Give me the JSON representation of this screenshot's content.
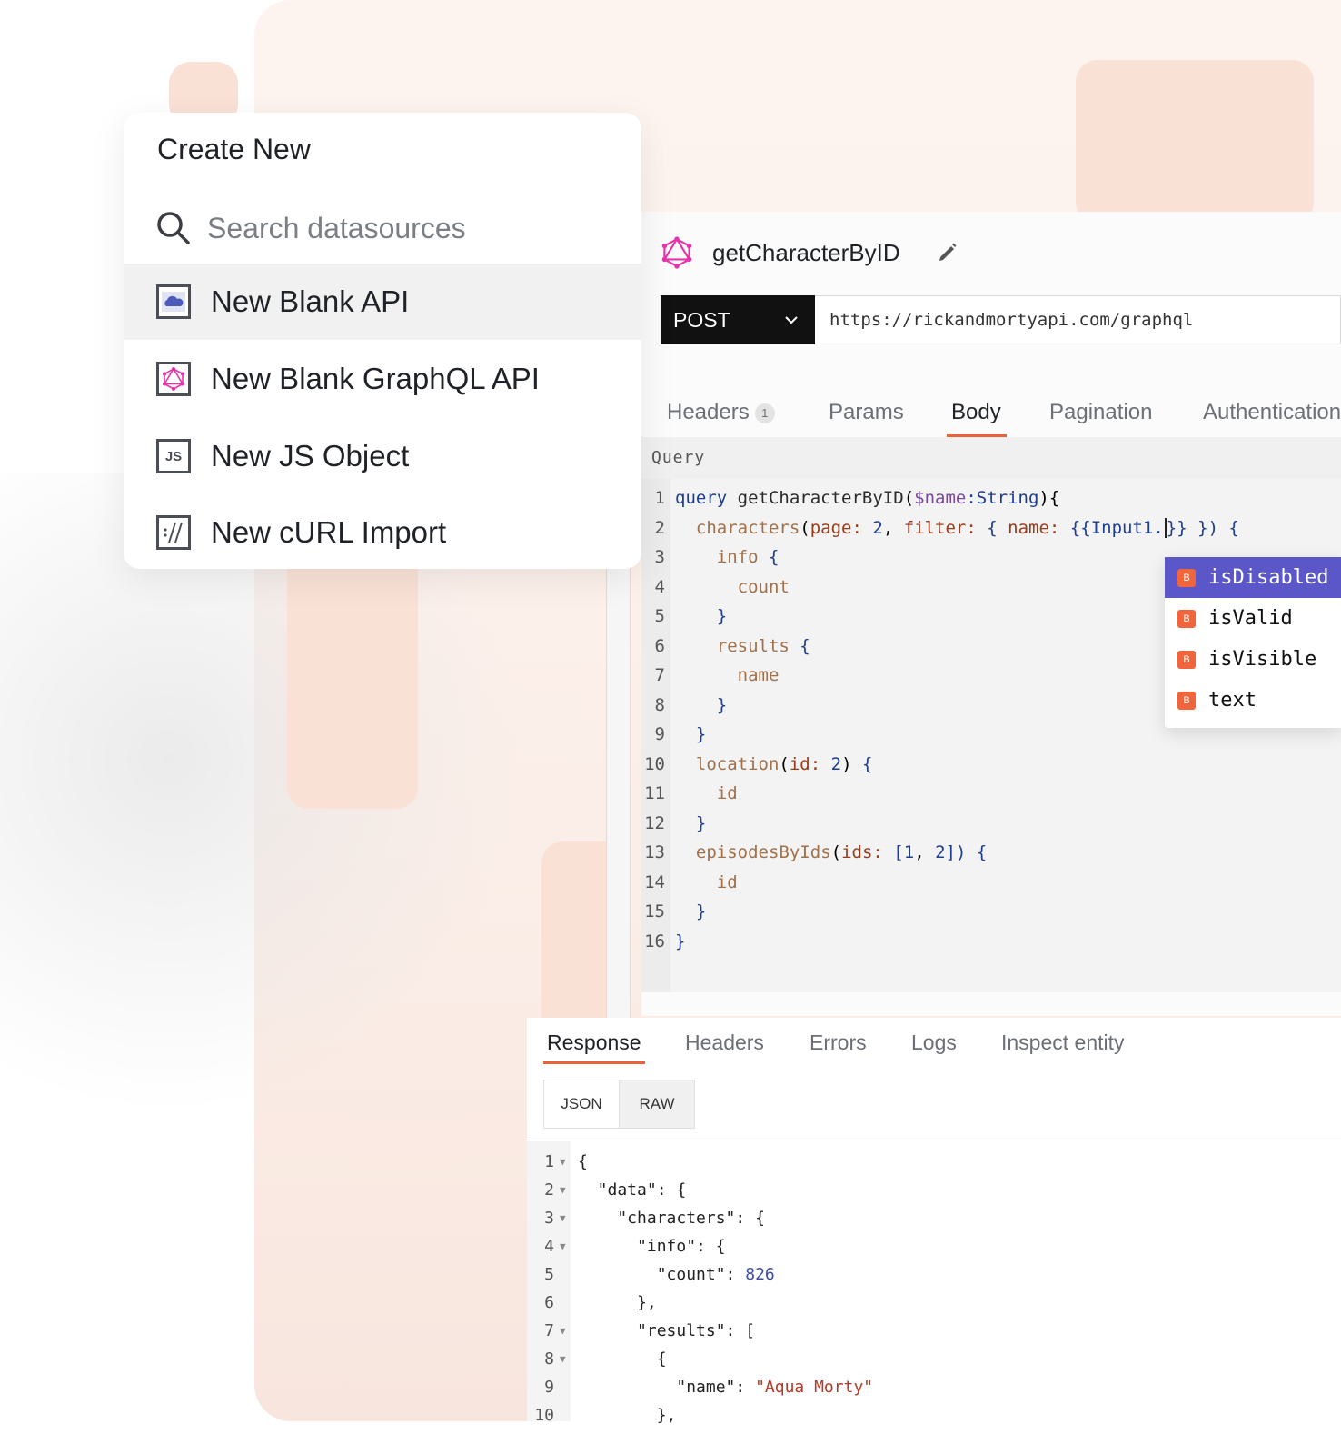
{
  "popover": {
    "title": "Create New",
    "search_placeholder": "Search datasources",
    "items": [
      {
        "label": "New Blank API"
      },
      {
        "label": "New Blank GraphQL API"
      },
      {
        "label": "New JS Object",
        "icon_text": "JS"
      },
      {
        "label": "New cURL Import"
      }
    ]
  },
  "editor": {
    "name": "getCharacterByID",
    "method": "POST",
    "url": "https://rickandmortyapi.com/graphql",
    "tabs": [
      {
        "label": "Headers",
        "badge": "1"
      },
      {
        "label": "Params"
      },
      {
        "label": "Body"
      },
      {
        "label": "Pagination"
      },
      {
        "label": "Authentication"
      }
    ],
    "active_tab": "Body",
    "query_label": "Query",
    "line_numbers": [
      "1",
      "2",
      "3",
      "4",
      "5",
      "6",
      "7",
      "8",
      "9",
      "10",
      "11",
      "12",
      "13",
      "14",
      "15",
      "16"
    ]
  },
  "autocomplete": {
    "badge": "B",
    "items": [
      "isDisabled",
      "isValid",
      "isVisible",
      "text"
    ],
    "selected": "isDisabled"
  },
  "response": {
    "tabs": [
      "Response",
      "Headers",
      "Errors",
      "Logs",
      "Inspect entity"
    ],
    "active_tab": "Response",
    "view_modes": [
      "JSON",
      "RAW"
    ],
    "line_numbers": [
      "1",
      "2",
      "3",
      "4",
      "5",
      "6",
      "7",
      "8",
      "9",
      "10"
    ],
    "count": "826",
    "name": "\"Aqua Morty\""
  },
  "colors": {
    "accent": "#e8623a",
    "autocomplete_selected": "#5b57c8",
    "boolean_badge": "#f0653c",
    "background_tint": "#fbeee8"
  }
}
